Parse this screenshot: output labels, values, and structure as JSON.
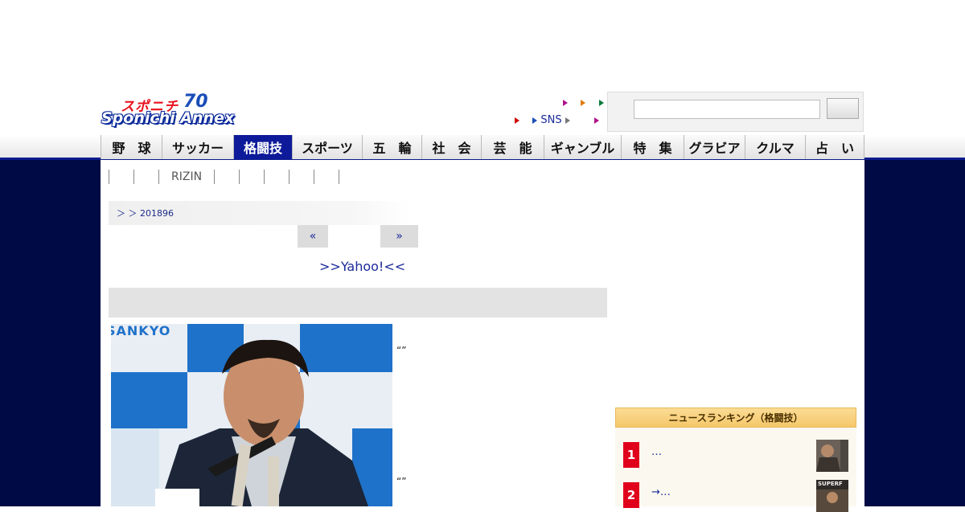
{
  "header": {
    "logo_kana": "スポニチ",
    "logo_latin": "Sponichi Annex",
    "logo_anniversary": "70",
    "sns_link": "SNS"
  },
  "search": {
    "placeholder": "",
    "button_label": ""
  },
  "nav": {
    "items": [
      {
        "label": "野　球"
      },
      {
        "label": "サッカー"
      },
      {
        "label": "格闘技"
      },
      {
        "label": "スポーツ"
      },
      {
        "label": "五　輪"
      },
      {
        "label": "社　会"
      },
      {
        "label": "芸　能"
      },
      {
        "label": "ギャンブル"
      },
      {
        "label": "特　集"
      },
      {
        "label": "グラビア"
      },
      {
        "label": "クルマ"
      },
      {
        "label": "占　い"
      }
    ],
    "active_index": 2
  },
  "subnav": {
    "rizin_label": "RIZIN"
  },
  "article": {
    "breadcrumb_text": "＞ ＞ 201896",
    "prev_label": "«",
    "next_label": "»",
    "yahoo_link": ">>Yahoo!<<",
    "quote_1": "“”",
    "quote_2": "“”",
    "photo_backdrop_text": "SANKYO"
  },
  "ranking": {
    "title": "ニュースランキング（格闘技）",
    "items": [
      {
        "rank": "1",
        "text": "…"
      },
      {
        "rank": "2",
        "text": "→…"
      }
    ],
    "thumb2_text": "SUPERF"
  },
  "colors": {
    "navy": "#000b45",
    "nav_active": "#0d1a99",
    "rank_red": "#e0001b",
    "link_blue": "#1a2a9a"
  }
}
